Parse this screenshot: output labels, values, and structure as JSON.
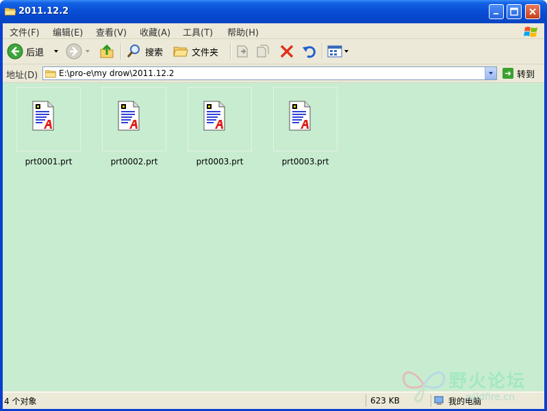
{
  "window": {
    "title": "2011.12.2"
  },
  "menu": {
    "items": [
      "文件(F)",
      "编辑(E)",
      "查看(V)",
      "收藏(A)",
      "工具(T)",
      "帮助(H)"
    ]
  },
  "toolbar": {
    "back_label": "后退",
    "search_label": "搜索",
    "folders_label": "文件夹"
  },
  "address": {
    "label": "地址(D)",
    "path": "E:\\pro-e\\my drow\\2011.12.2",
    "go_label": "转到"
  },
  "files": [
    {
      "name": "prt0001.prt"
    },
    {
      "name": "prt0002.prt"
    },
    {
      "name": "prt0003.prt"
    },
    {
      "name": "prt0003.prt"
    }
  ],
  "status": {
    "objects": "4 个对象",
    "size": "623 KB",
    "location": "我的电脑"
  },
  "watermark": {
    "title": "野火论坛",
    "url": "wildfire.cn"
  },
  "colors": {
    "content_bg": "#c8ecd0",
    "title_blue": "#0a52d8",
    "chrome": "#ece9d8"
  }
}
